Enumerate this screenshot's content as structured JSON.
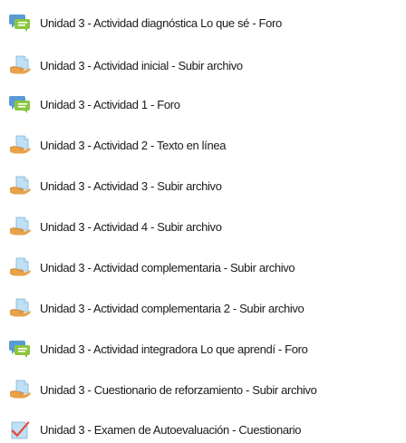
{
  "activities": [
    {
      "label": "Unidad 3 - Actividad diagnóstica Lo que sé - Foro",
      "icon": "forum-icon"
    },
    {
      "label": "Unidad 3 - Actividad inicial - Subir archivo",
      "icon": "assignment-icon"
    },
    {
      "label": "Unidad 3 - Actividad 1 - Foro",
      "icon": "forum-icon"
    },
    {
      "label": "Unidad 3 - Actividad 2 - Texto en línea",
      "icon": "assignment-icon"
    },
    {
      "label": "Unidad 3 - Actividad 3 - Subir archivo",
      "icon": "assignment-icon"
    },
    {
      "label": "Unidad 3 - Actividad 4 - Subir archivo",
      "icon": "assignment-icon"
    },
    {
      "label": "Unidad 3 - Actividad complementaria - Subir archivo",
      "icon": "assignment-icon"
    },
    {
      "label": "Unidad 3 - Actividad complementaria 2 - Subir archivo",
      "icon": "assignment-icon"
    },
    {
      "label": "Unidad 3 - Actividad integradora Lo que aprendí - Foro",
      "icon": "forum-icon"
    },
    {
      "label": "Unidad 3 - Cuestionario de reforzamiento - Subir archivo",
      "icon": "assignment-icon"
    },
    {
      "label": "Unidad 3 - Examen de Autoevaluación - Cuestionario",
      "icon": "quiz-icon"
    }
  ],
  "colors": {
    "forum_back": "#5b9bd5",
    "forum_front": "#8cc63f",
    "assignment_hand": "#e8a24a",
    "assignment_paper": "#bfe0f5",
    "quiz_paper": "#bfe0f5",
    "quiz_check": "#e84c3d",
    "text": "#1a1a1a"
  }
}
